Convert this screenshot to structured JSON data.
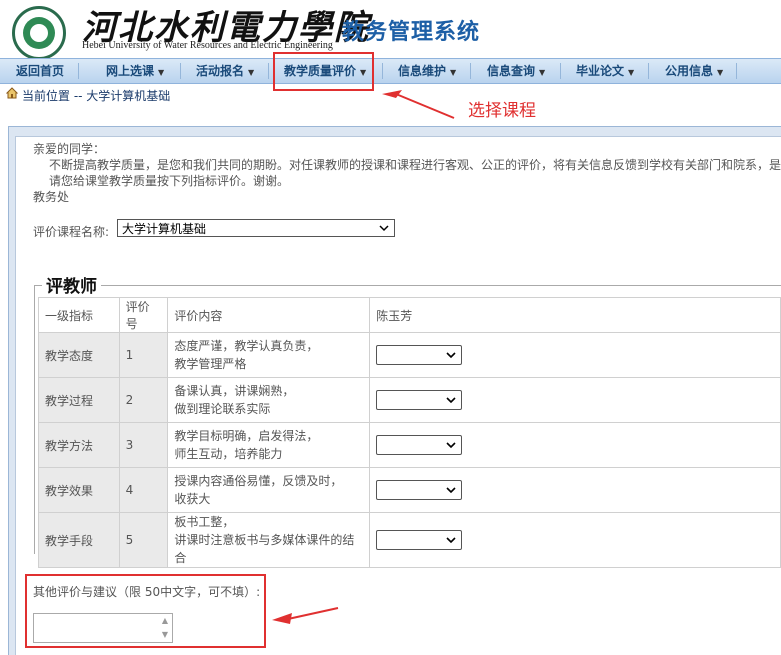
{
  "header": {
    "school_cn": "河北水利電力學院",
    "school_en": "Hebei University of Water Resources and Electric Engineering",
    "system_title": "教务管理系统"
  },
  "nav": {
    "items": [
      {
        "label": "返回首页",
        "has_menu": false
      },
      {
        "label": "网上选课",
        "has_menu": true
      },
      {
        "label": "活动报名",
        "has_menu": true
      },
      {
        "label": "教学质量评价",
        "has_menu": true
      },
      {
        "label": "信息维护",
        "has_menu": true
      },
      {
        "label": "信息查询",
        "has_menu": true
      },
      {
        "label": "毕业论文",
        "has_menu": true
      },
      {
        "label": "公用信息",
        "has_menu": true
      }
    ],
    "dropdown_arrow": "▼"
  },
  "breadcrumb": {
    "text": "当前位置 -- 大学计算机基础"
  },
  "annotations": {
    "select_course": "选择课程",
    "color": "#e03030"
  },
  "intro": {
    "greeting": "亲爱的同学：",
    "line1": "不断提高教学质量，是您和我们共同的期盼。对任课教师的授课和课程进行客观、公正的评价，将有关信息反馈到学校有关部门和院系，是",
    "line2": "请您给课堂教学质量按下列指标评价。谢谢。",
    "signature": "教务处"
  },
  "course_select": {
    "label": "评价课程名称:",
    "value": "大学计算机基础"
  },
  "evaluation": {
    "legend": "评教师",
    "columns": [
      "一级指标",
      "评价号",
      "评价内容",
      "陈玉芳"
    ],
    "rows": [
      {
        "indicator": "教学态度",
        "num": "1",
        "content1": "态度严谨，教学认真负责，",
        "content2": "教学管理严格",
        "rating": ""
      },
      {
        "indicator": "教学过程",
        "num": "2",
        "content1": "备课认真，讲课娴熟，",
        "content2": "做到理论联系实际",
        "rating": ""
      },
      {
        "indicator": "教学方法",
        "num": "3",
        "content1": "教学目标明确，启发得法，",
        "content2": "师生互动，培养能力",
        "rating": ""
      },
      {
        "indicator": "教学效果",
        "num": "4",
        "content1": "授课内容通俗易懂，反馈及时，",
        "content2": "收获大",
        "rating": ""
      },
      {
        "indicator": "教学手段",
        "num": "5",
        "content1": "板书工整，",
        "content2": "讲课时注意板书与多媒体课件的结合",
        "rating": ""
      }
    ]
  },
  "other": {
    "label": "其他评价与建议（限 50中文字，可不填）:",
    "value": ""
  },
  "colors": {
    "nav_bg": "#b9d3ee",
    "title_blue": "#1d5fa6",
    "highlight_red": "#e03030"
  }
}
